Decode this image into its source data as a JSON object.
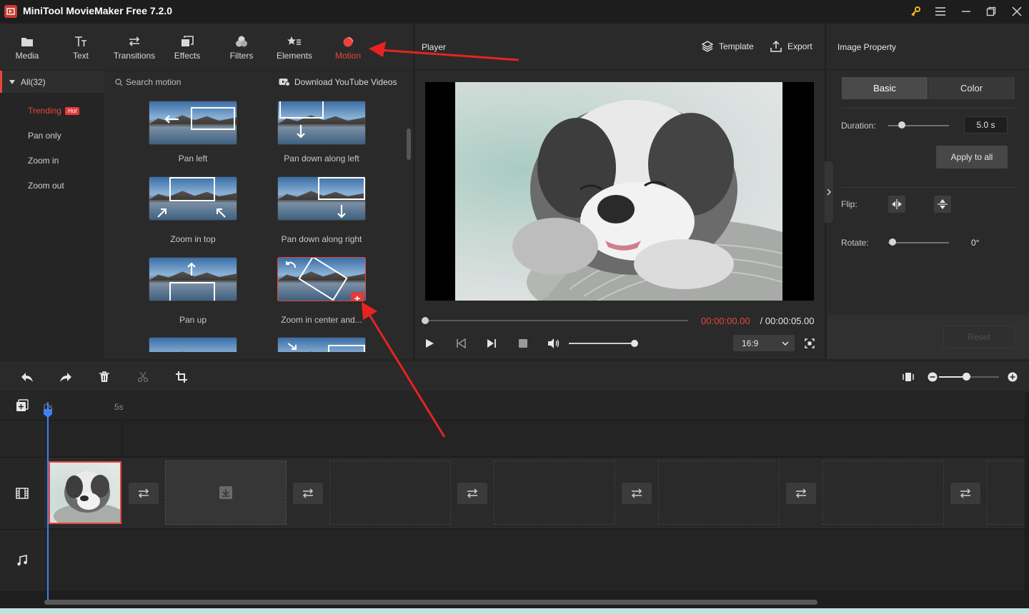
{
  "app": {
    "title": "MiniTool MovieMaker Free 7.2.0"
  },
  "toolbar": {
    "items": [
      {
        "label": "Media",
        "icon": "folder-icon"
      },
      {
        "label": "Text",
        "icon": "text-icon"
      },
      {
        "label": "Transitions",
        "icon": "transitions-icon"
      },
      {
        "label": "Effects",
        "icon": "effects-icon"
      },
      {
        "label": "Filters",
        "icon": "filters-icon"
      },
      {
        "label": "Elements",
        "icon": "elements-icon"
      },
      {
        "label": "Motion",
        "icon": "motion-icon",
        "active": true
      }
    ]
  },
  "library": {
    "category_all": "All(32)",
    "categories": [
      "Trending",
      "Pan only",
      "Zoom in",
      "Zoom out"
    ],
    "hot_badge": "Hot",
    "search_placeholder": "Search motion",
    "download_label": "Download YouTube Videos",
    "motions": [
      "Pan left",
      "Pan down along left",
      "Zoom in top",
      "Pan down along right",
      "Pan up",
      "Zoom in center and..."
    ]
  },
  "player": {
    "title": "Player",
    "template_label": "Template",
    "export_label": "Export",
    "time_current": "00:00:00.00",
    "time_separator": " / ",
    "time_total": "00:00:05.00",
    "aspect_ratio": "16:9",
    "progress_fraction": 0.0,
    "volume_fraction": 1.0
  },
  "properties": {
    "title": "Image Property",
    "tabs": [
      "Basic",
      "Color"
    ],
    "duration_label": "Duration:",
    "duration_value": "5.0 s",
    "apply_all_label": "Apply to all",
    "flip_label": "Flip:",
    "rotate_label": "Rotate:",
    "rotate_value": "0°",
    "reset_label": "Reset"
  },
  "timeline": {
    "ruler_labels": [
      "0s",
      "5s"
    ],
    "zoom_fraction": 0.45
  },
  "colors": {
    "accent": "#e8463c",
    "playhead": "#3b82f6",
    "background": "#232323"
  }
}
